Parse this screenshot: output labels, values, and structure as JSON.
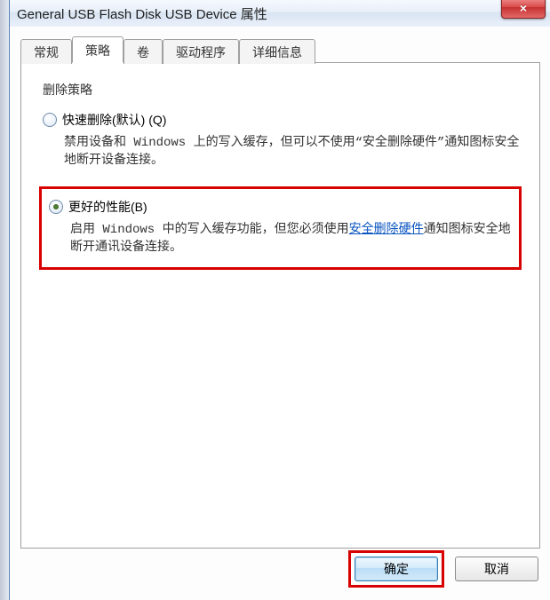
{
  "window": {
    "title": "General USB Flash Disk USB Device 属性",
    "close_icon": "×"
  },
  "tabs": {
    "general": "常规",
    "policies": "策略",
    "volumes": "卷",
    "driver": "驱动程序",
    "details": "详细信息"
  },
  "group": {
    "title": "删除策略"
  },
  "option1": {
    "label": "快速删除(默认) (Q)",
    "desc": "禁用设备和 Windows 上的写入缓存，但可以不使用“安全删除硬件”通知图标安全地断开设备连接。"
  },
  "option2": {
    "label": "更好的性能(B)",
    "desc_pre": "启用 Windows 中的写入缓存功能，但您必须使用",
    "link": "安全删除硬件",
    "desc_post": "通知图标安全地断开通讯设备连接。"
  },
  "buttons": {
    "ok": "确定",
    "cancel": "取消"
  }
}
